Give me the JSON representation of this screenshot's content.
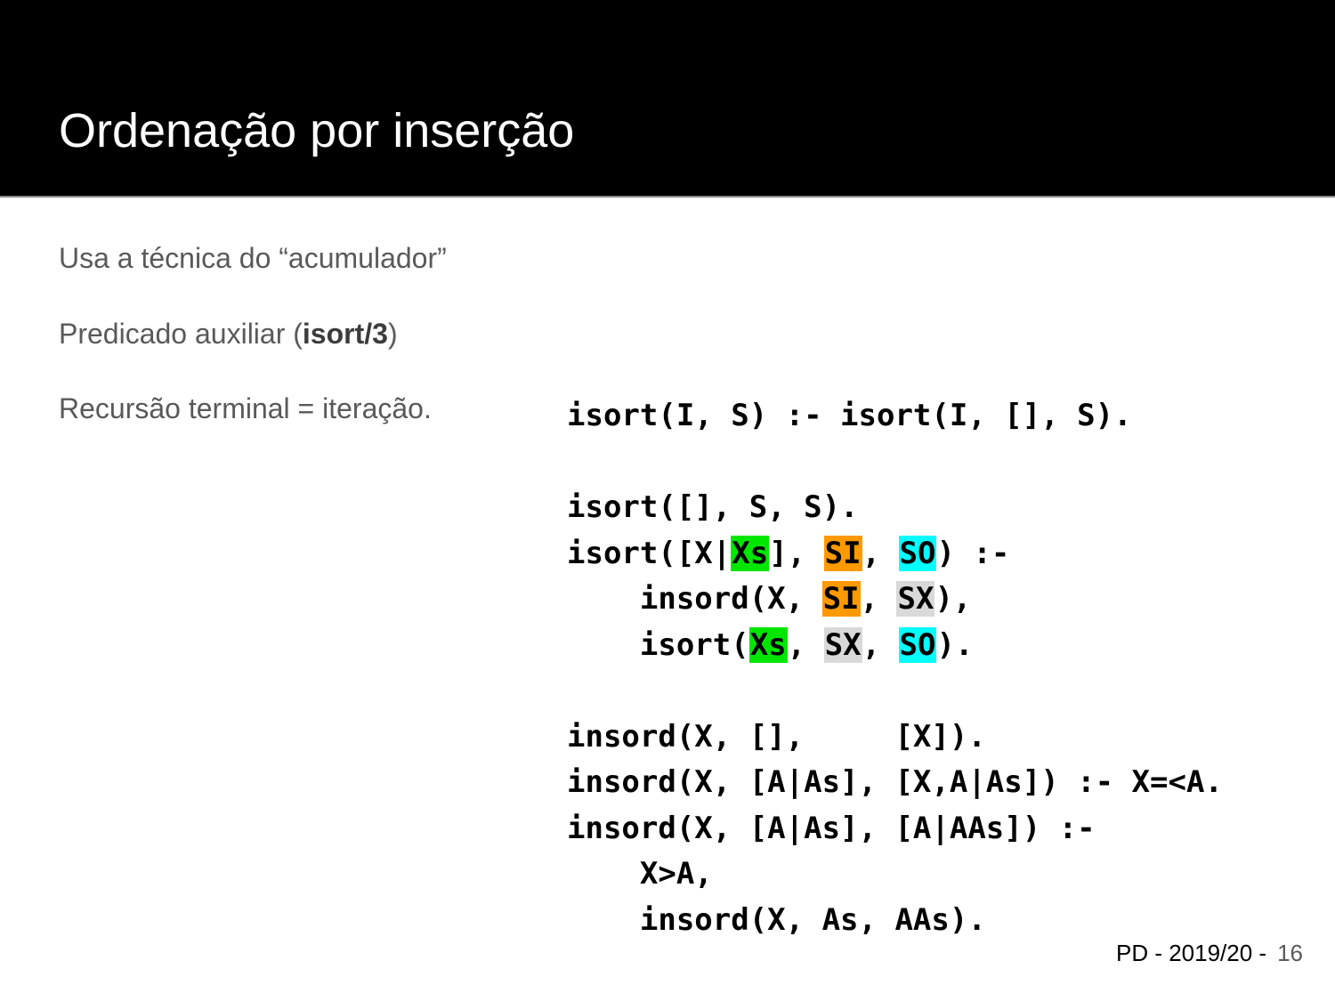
{
  "slide": {
    "title": "Ordenação por inserção",
    "bullets": [
      {
        "text": "Usa a técnica do “acumulador”"
      },
      {
        "pre": "Predicado auxiliar (",
        "bold": "isort/3",
        "post": ")"
      },
      {
        "text": "Recursão terminal = iteração."
      }
    ]
  },
  "code": {
    "highlight_colors": {
      "Xs": "#00e600",
      "SI": "#ff9900",
      "SO": "#00ffff",
      "SX": "#d9d9d9"
    },
    "lines": [
      [
        {
          "t": "isort(I, S) :- isort(I, [], S)."
        }
      ],
      [
        {
          "t": ""
        }
      ],
      [
        {
          "t": "isort([], S, S)."
        }
      ],
      [
        {
          "t": "isort([X|"
        },
        {
          "t": "Xs",
          "hl": "#00e600"
        },
        {
          "t": "], "
        },
        {
          "t": "SI",
          "hl": "#ff9900"
        },
        {
          "t": ", "
        },
        {
          "t": "SO",
          "hl": "#00ffff"
        },
        {
          "t": ") :-"
        }
      ],
      [
        {
          "t": "    insord(X, "
        },
        {
          "t": "SI",
          "hl": "#ff9900"
        },
        {
          "t": ", "
        },
        {
          "t": "SX",
          "hl": "#d9d9d9"
        },
        {
          "t": "),"
        }
      ],
      [
        {
          "t": "    isort("
        },
        {
          "t": "Xs",
          "hl": "#00e600"
        },
        {
          "t": ", "
        },
        {
          "t": "SX",
          "hl": "#d9d9d9"
        },
        {
          "t": ", "
        },
        {
          "t": "SO",
          "hl": "#00ffff"
        },
        {
          "t": ")."
        }
      ],
      [
        {
          "t": ""
        }
      ],
      [
        {
          "t": "insord(X, [],     [X])."
        }
      ],
      [
        {
          "t": "insord(X, [A|As], [X,A|As]) :- X=<A."
        }
      ],
      [
        {
          "t": "insord(X, [A|As], [A|AAs]) :-"
        }
      ],
      [
        {
          "t": "    X>A,"
        }
      ],
      [
        {
          "t": "    insord(X, As, AAs)."
        }
      ]
    ]
  },
  "footer": {
    "course": "PD - 2019/20 -",
    "page": "16"
  }
}
